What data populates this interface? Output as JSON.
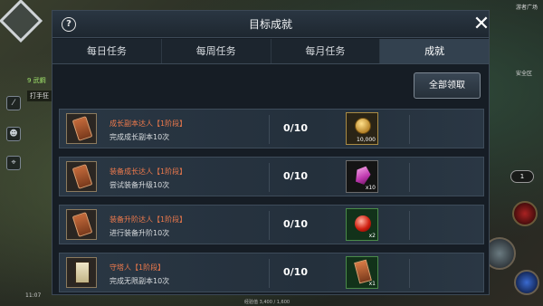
{
  "hud": {
    "chat_level": "9 武鋼",
    "chat_line": "打手狂",
    "top_right": "游者广场",
    "safe_zone": "安全区",
    "time": "11:07",
    "hp_button": "1",
    "exp_text": "经验值 3,400 / 1,600"
  },
  "panel": {
    "title": "目标成就",
    "help_icon": "?",
    "close_icon": "✕"
  },
  "tabs": [
    {
      "label": "每日任务",
      "active": false
    },
    {
      "label": "每周任务",
      "active": false
    },
    {
      "label": "每月任务",
      "active": false
    },
    {
      "label": "成就",
      "active": true
    }
  ],
  "claim_all_label": "全部领取",
  "achievements": [
    {
      "name": "成长副本达人【1阶段】",
      "desc": "完成成长副本10次",
      "progress": "0/10",
      "reward_icon": "coin-icon",
      "reward_qty": "10,000"
    },
    {
      "name": "装备成长达人【1阶段】",
      "desc": "尝试装备升级10次",
      "progress": "0/10",
      "reward_icon": "gem-icon",
      "reward_qty": "x10"
    },
    {
      "name": "装备升阶达人【1阶段】",
      "desc": "进行装备升阶10次",
      "progress": "0/10",
      "reward_icon": "orb-icon",
      "reward_qty": "x2"
    },
    {
      "name": "守塔人【1阶段】",
      "desc": "完成无限副本10次",
      "progress": "0/10",
      "reward_icon": "ticket-icon",
      "reward_qty": "x1"
    }
  ]
}
